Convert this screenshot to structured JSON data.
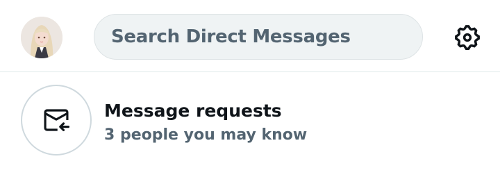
{
  "header": {
    "avatar_icon": "user-avatar",
    "search_placeholder": "Search Direct Messages",
    "settings_icon": "gear-icon"
  },
  "message_requests": {
    "icon": "envelope-arrow-icon",
    "title": "Message requests",
    "subtitle": "3 people you may know"
  },
  "colors": {
    "text_primary": "#0f1419",
    "text_secondary": "#536471",
    "search_bg": "#eff3f4",
    "divider": "#dfe9ea",
    "icon_border": "#cfd9de"
  }
}
